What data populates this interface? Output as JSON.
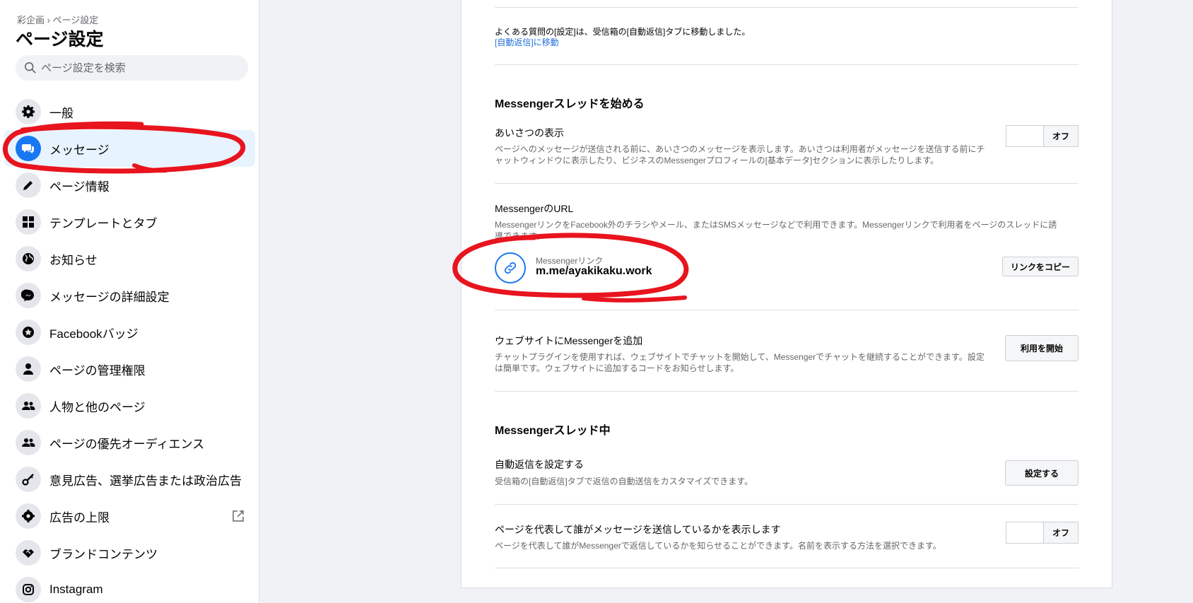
{
  "sidebar": {
    "breadcrumb": "彩企画 › ページ設定",
    "title": "ページ設定",
    "search_placeholder": "ページ設定を検索",
    "items": [
      {
        "label": "一般",
        "icon": "gear-icon"
      },
      {
        "label": "メッセージ",
        "icon": "chat-icon",
        "active": true
      },
      {
        "label": "ページ情報",
        "icon": "pencil-icon"
      },
      {
        "label": "テンプレートとタブ",
        "icon": "grid-icon"
      },
      {
        "label": "お知らせ",
        "icon": "globe-icon"
      },
      {
        "label": "メッセージの詳細設定",
        "icon": "messenger-icon"
      },
      {
        "label": "Facebookバッジ",
        "icon": "badge-icon"
      },
      {
        "label": "ページの管理権限",
        "icon": "person-icon"
      },
      {
        "label": "人物と他のページ",
        "icon": "people-icon"
      },
      {
        "label": "ページの優先オーディエンス",
        "icon": "people-icon"
      },
      {
        "label": "意見広告、選挙広告または政治広告",
        "icon": "key-icon"
      },
      {
        "label": "広告の上限",
        "icon": "gear-icon",
        "external": true
      },
      {
        "label": "ブランドコンテンツ",
        "icon": "handshake-icon"
      },
      {
        "label": "Instagram",
        "icon": "instagram-icon"
      }
    ]
  },
  "main": {
    "faq_notice": "よくある質問の[設定]は、受信箱の[自動返信]タブに移動しました。",
    "faq_link": "[自動返信]に移動",
    "start_section": {
      "title": "Messengerスレッドを始める",
      "greeting": {
        "title": "あいさつの表示",
        "desc_line1": "ページへのメッセージが送信される前に、あいさつのメッセージを表示します。あいさつは利用者がメッセージを送信する前にチ",
        "desc_line2": "ャットウィンドウに表示したり、ビジネスのMessengerプロフィールの[基本データ]セクションに表示したりします。",
        "toggle": "オフ"
      },
      "url": {
        "title": "MessengerのURL",
        "desc_line1": "MessengerリンクをFacebook外のチラシやメール、またはSMSメッセージなどで利用できます。Messengerリンクで利用者をページのスレッドに誘",
        "desc_line2": "導できます。",
        "link_label": "Messengerリンク",
        "link_url": "m.me/ayakikaku.work",
        "copy_button": "リンクをコピー"
      },
      "website": {
        "title": "ウェブサイトにMessengerを追加",
        "desc_line1": "チャットプラグインを使用すれば、ウェブサイトでチャットを開始して、Messengerでチャットを継続することができます。設定",
        "desc_line2": "は簡単です。ウェブサイトに追加するコードをお知らせします。",
        "button": "利用を開始"
      }
    },
    "in_thread_section": {
      "title": "Messengerスレッド中",
      "auto_reply": {
        "title": "自動返信を設定する",
        "desc": "受信箱の[自動返信]タブで返信の自動送信をカスタマイズできます。",
        "button": "設定する"
      },
      "show_sender": {
        "title": "ページを代表して誰がメッセージを送信しているかを表示します",
        "desc": "ページを代表して誰がMessengerで返信しているかを知らせることができます。名前を表示する方法を選択できます。",
        "toggle": "オフ"
      }
    }
  },
  "colors": {
    "accent": "#1877f2",
    "annotation": "#e8141e",
    "active_bg": "#e7f3ff"
  }
}
